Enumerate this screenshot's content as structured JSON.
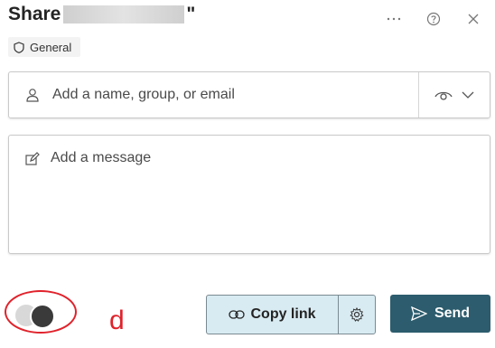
{
  "header": {
    "title_prefix": "Share",
    "title_quote_close": "\"",
    "more_icon": "ellipsis-icon",
    "help_icon": "help-circle-icon",
    "close_icon": "close-icon"
  },
  "sensitivity": {
    "label": "General",
    "icon": "shield-icon"
  },
  "recipients": {
    "placeholder": "Add a name, group, or email",
    "icon": "person-icon",
    "permission_icon": "eye-icon",
    "dropdown_icon": "chevron-down-icon"
  },
  "message": {
    "placeholder": "Add a message",
    "icon": "edit-icon"
  },
  "annotation": {
    "letter": "d",
    "color": "#e0222b"
  },
  "actions": {
    "copy_link_label": "Copy link",
    "copy_link_icon": "link-icon",
    "settings_icon": "gear-icon",
    "send_label": "Send",
    "send_icon": "send-icon"
  },
  "colors": {
    "send_bg": "#2c5c6d",
    "copy_link_bg": "#d9ebf2"
  }
}
